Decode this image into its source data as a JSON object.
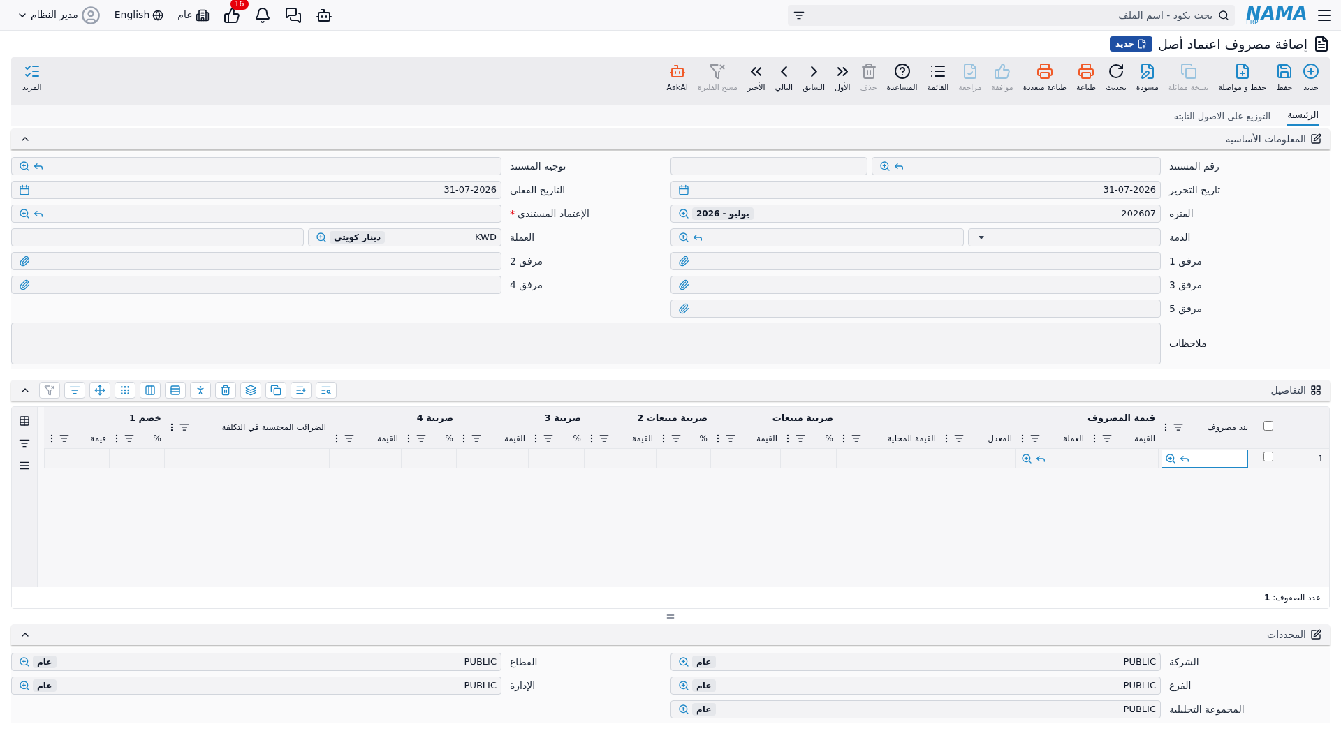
{
  "topbar": {
    "logo": "NAMA",
    "logo_sub": "ERP",
    "search_placeholder": "بحث بكود - اسم الملف",
    "notifications": "16",
    "branch": "عام",
    "language": "English",
    "user": "مدير النظام"
  },
  "page": {
    "title": "إضافة مصروف اعتماد أصل",
    "badge": "جديد"
  },
  "toolbar": [
    {
      "label": "جديد",
      "disabled": false
    },
    {
      "label": "حفظ",
      "disabled": false
    },
    {
      "label": "حفظ و مواصلة",
      "disabled": false
    },
    {
      "label": "نسخة مماثلة",
      "disabled": true
    },
    {
      "label": "مسودة",
      "disabled": false
    },
    {
      "label": "تحديث",
      "disabled": false
    },
    {
      "label": "طباعة",
      "disabled": false
    },
    {
      "label": "طباعة متعددة",
      "disabled": false
    },
    {
      "label": "موافقة",
      "disabled": true
    },
    {
      "label": "مراجعة",
      "disabled": true
    },
    {
      "label": "القائمة",
      "disabled": false
    },
    {
      "label": "المساعدة",
      "disabled": false
    },
    {
      "label": "حذف",
      "disabled": true
    },
    {
      "label": "الأول",
      "disabled": false
    },
    {
      "label": "السابق",
      "disabled": false
    },
    {
      "label": "التالي",
      "disabled": false
    },
    {
      "label": "الأخير",
      "disabled": false
    },
    {
      "label": "مسح الفلترة",
      "disabled": true
    },
    {
      "label": "AskAI",
      "disabled": false
    }
  ],
  "more": "المزيد",
  "tabs": [
    {
      "label": "الرئيسية",
      "selected": true
    },
    {
      "label": "التوزيع على الاصول الثابته",
      "selected": false
    }
  ],
  "basic": {
    "title": "المعلومات الأساسية",
    "expanded": true,
    "rows": [
      [
        {
          "label": "رقم المستند",
          "kind": "split"
        },
        {
          "label": "توجيه المستند",
          "kind": "lookup"
        }
      ],
      [
        {
          "label": "تاريخ التحرير",
          "kind": "date",
          "value": "31-07-2026"
        },
        {
          "label": "التاريخ الفعلي",
          "kind": "date",
          "value": "31-07-2026"
        }
      ],
      [
        {
          "label": "الفترة",
          "kind": "chip",
          "value": "202607",
          "chip": "يوليو - 2026"
        },
        {
          "label": "الإعتماد المستندي",
          "kind": "lookup",
          "required_mark": "*"
        }
      ],
      [
        {
          "label": "الذمة",
          "kind": "dropdown"
        },
        {
          "label": "العملة",
          "kind": "currency",
          "value": "KWD",
          "chip": "دينار كويتي"
        }
      ],
      [
        {
          "label": "مرفق 1",
          "kind": "attachment"
        },
        {
          "label": "مرفق 2",
          "kind": "attachment"
        }
      ],
      [
        {
          "label": "مرفق 3",
          "kind": "attachment"
        },
        {
          "label": "مرفق 4",
          "kind": "attachment"
        }
      ],
      [
        {
          "label": "مرفق 5",
          "kind": "attachment"
        }
      ]
    ],
    "notes_label": "ملاحظات"
  },
  "details": {
    "title": "التفاصيل",
    "expanded": true,
    "tools": [
      {
        "disabled": false
      },
      {
        "disabled": false
      },
      {
        "disabled": false
      },
      {
        "disabled": false
      },
      {
        "disabled": false
      },
      {
        "disabled": false
      },
      {
        "disabled": false
      },
      {
        "disabled": false
      },
      {
        "disabled": false
      },
      {
        "disabled": false
      },
      {
        "disabled": false
      },
      {
        "disabled": true
      }
    ],
    "columns": [
      {
        "label": "بند مصروف",
        "kind": "lookup"
      },
      {
        "label": "قيمة المصروف",
        "children": [
          {
            "label": "القيمة"
          },
          {
            "label": "العملة",
            "kind": "lookup"
          },
          {
            "label": "المعدل"
          },
          {
            "label": "القيمة المحلية"
          }
        ]
      },
      {
        "label": "ضريبة مبيعات",
        "children": [
          {
            "label": "%"
          },
          {
            "label": "القيمة"
          }
        ]
      },
      {
        "label": "ضريبة مبيعات 2",
        "children": [
          {
            "label": "%"
          },
          {
            "label": "القيمة"
          }
        ]
      },
      {
        "label": "ضريبة 3",
        "children": [
          {
            "label": "%"
          },
          {
            "label": "القيمة"
          }
        ]
      },
      {
        "label": "ضريبة 4",
        "children": [
          {
            "label": "%"
          },
          {
            "label": "القيمة"
          }
        ]
      },
      {
        "label": "الضرائب المحتسبة في التكلفة"
      },
      {
        "label": "خصم 1",
        "children": [
          {
            "label": "%"
          },
          {
            "label": "قيمة"
          }
        ]
      }
    ],
    "select_all": {
      "checked": false
    },
    "rows": [
      {
        "number": "1",
        "selected": false
      }
    ],
    "footer": "عدد الصفوف: **1**"
  },
  "determinants": {
    "title": "المحددات",
    "expanded": true,
    "rows": [
      [
        {
          "label": "الشركة",
          "kind": "chip",
          "value": "PUBLIC",
          "chip": "عام"
        },
        {
          "label": "القطاع",
          "kind": "chip",
          "value": "PUBLIC",
          "chip": "عام"
        }
      ],
      [
        {
          "label": "الفرع",
          "kind": "chip",
          "value": "PUBLIC",
          "chip": "عام"
        },
        {
          "label": "الإدارة",
          "kind": "chip",
          "value": "PUBLIC",
          "chip": "عام"
        }
      ],
      [
        {
          "label": "المجموعة التحليلية",
          "kind": "chip",
          "value": "PUBLIC",
          "chip": "عام"
        }
      ]
    ]
  }
}
